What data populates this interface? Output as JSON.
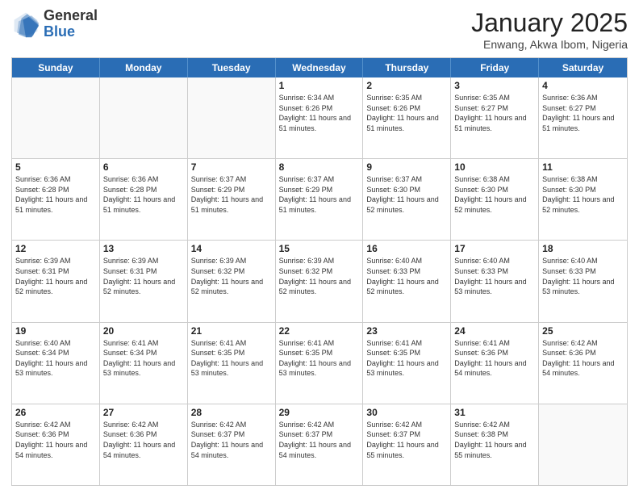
{
  "header": {
    "logo_general": "General",
    "logo_blue": "Blue",
    "month_title": "January 2025",
    "subtitle": "Enwang, Akwa Ibom, Nigeria"
  },
  "weekdays": [
    "Sunday",
    "Monday",
    "Tuesday",
    "Wednesday",
    "Thursday",
    "Friday",
    "Saturday"
  ],
  "weeks": [
    [
      {
        "day": "",
        "sunrise": "",
        "sunset": "",
        "daylight": "",
        "empty": true
      },
      {
        "day": "",
        "sunrise": "",
        "sunset": "",
        "daylight": "",
        "empty": true
      },
      {
        "day": "",
        "sunrise": "",
        "sunset": "",
        "daylight": "",
        "empty": true
      },
      {
        "day": "1",
        "sunrise": "Sunrise: 6:34 AM",
        "sunset": "Sunset: 6:26 PM",
        "daylight": "Daylight: 11 hours and 51 minutes.",
        "empty": false
      },
      {
        "day": "2",
        "sunrise": "Sunrise: 6:35 AM",
        "sunset": "Sunset: 6:26 PM",
        "daylight": "Daylight: 11 hours and 51 minutes.",
        "empty": false
      },
      {
        "day": "3",
        "sunrise": "Sunrise: 6:35 AM",
        "sunset": "Sunset: 6:27 PM",
        "daylight": "Daylight: 11 hours and 51 minutes.",
        "empty": false
      },
      {
        "day": "4",
        "sunrise": "Sunrise: 6:36 AM",
        "sunset": "Sunset: 6:27 PM",
        "daylight": "Daylight: 11 hours and 51 minutes.",
        "empty": false
      }
    ],
    [
      {
        "day": "5",
        "sunrise": "Sunrise: 6:36 AM",
        "sunset": "Sunset: 6:28 PM",
        "daylight": "Daylight: 11 hours and 51 minutes.",
        "empty": false
      },
      {
        "day": "6",
        "sunrise": "Sunrise: 6:36 AM",
        "sunset": "Sunset: 6:28 PM",
        "daylight": "Daylight: 11 hours and 51 minutes.",
        "empty": false
      },
      {
        "day": "7",
        "sunrise": "Sunrise: 6:37 AM",
        "sunset": "Sunset: 6:29 PM",
        "daylight": "Daylight: 11 hours and 51 minutes.",
        "empty": false
      },
      {
        "day": "8",
        "sunrise": "Sunrise: 6:37 AM",
        "sunset": "Sunset: 6:29 PM",
        "daylight": "Daylight: 11 hours and 51 minutes.",
        "empty": false
      },
      {
        "day": "9",
        "sunrise": "Sunrise: 6:37 AM",
        "sunset": "Sunset: 6:30 PM",
        "daylight": "Daylight: 11 hours and 52 minutes.",
        "empty": false
      },
      {
        "day": "10",
        "sunrise": "Sunrise: 6:38 AM",
        "sunset": "Sunset: 6:30 PM",
        "daylight": "Daylight: 11 hours and 52 minutes.",
        "empty": false
      },
      {
        "day": "11",
        "sunrise": "Sunrise: 6:38 AM",
        "sunset": "Sunset: 6:30 PM",
        "daylight": "Daylight: 11 hours and 52 minutes.",
        "empty": false
      }
    ],
    [
      {
        "day": "12",
        "sunrise": "Sunrise: 6:39 AM",
        "sunset": "Sunset: 6:31 PM",
        "daylight": "Daylight: 11 hours and 52 minutes.",
        "empty": false
      },
      {
        "day": "13",
        "sunrise": "Sunrise: 6:39 AM",
        "sunset": "Sunset: 6:31 PM",
        "daylight": "Daylight: 11 hours and 52 minutes.",
        "empty": false
      },
      {
        "day": "14",
        "sunrise": "Sunrise: 6:39 AM",
        "sunset": "Sunset: 6:32 PM",
        "daylight": "Daylight: 11 hours and 52 minutes.",
        "empty": false
      },
      {
        "day": "15",
        "sunrise": "Sunrise: 6:39 AM",
        "sunset": "Sunset: 6:32 PM",
        "daylight": "Daylight: 11 hours and 52 minutes.",
        "empty": false
      },
      {
        "day": "16",
        "sunrise": "Sunrise: 6:40 AM",
        "sunset": "Sunset: 6:33 PM",
        "daylight": "Daylight: 11 hours and 52 minutes.",
        "empty": false
      },
      {
        "day": "17",
        "sunrise": "Sunrise: 6:40 AM",
        "sunset": "Sunset: 6:33 PM",
        "daylight": "Daylight: 11 hours and 53 minutes.",
        "empty": false
      },
      {
        "day": "18",
        "sunrise": "Sunrise: 6:40 AM",
        "sunset": "Sunset: 6:33 PM",
        "daylight": "Daylight: 11 hours and 53 minutes.",
        "empty": false
      }
    ],
    [
      {
        "day": "19",
        "sunrise": "Sunrise: 6:40 AM",
        "sunset": "Sunset: 6:34 PM",
        "daylight": "Daylight: 11 hours and 53 minutes.",
        "empty": false
      },
      {
        "day": "20",
        "sunrise": "Sunrise: 6:41 AM",
        "sunset": "Sunset: 6:34 PM",
        "daylight": "Daylight: 11 hours and 53 minutes.",
        "empty": false
      },
      {
        "day": "21",
        "sunrise": "Sunrise: 6:41 AM",
        "sunset": "Sunset: 6:35 PM",
        "daylight": "Daylight: 11 hours and 53 minutes.",
        "empty": false
      },
      {
        "day": "22",
        "sunrise": "Sunrise: 6:41 AM",
        "sunset": "Sunset: 6:35 PM",
        "daylight": "Daylight: 11 hours and 53 minutes.",
        "empty": false
      },
      {
        "day": "23",
        "sunrise": "Sunrise: 6:41 AM",
        "sunset": "Sunset: 6:35 PM",
        "daylight": "Daylight: 11 hours and 53 minutes.",
        "empty": false
      },
      {
        "day": "24",
        "sunrise": "Sunrise: 6:41 AM",
        "sunset": "Sunset: 6:36 PM",
        "daylight": "Daylight: 11 hours and 54 minutes.",
        "empty": false
      },
      {
        "day": "25",
        "sunrise": "Sunrise: 6:42 AM",
        "sunset": "Sunset: 6:36 PM",
        "daylight": "Daylight: 11 hours and 54 minutes.",
        "empty": false
      }
    ],
    [
      {
        "day": "26",
        "sunrise": "Sunrise: 6:42 AM",
        "sunset": "Sunset: 6:36 PM",
        "daylight": "Daylight: 11 hours and 54 minutes.",
        "empty": false
      },
      {
        "day": "27",
        "sunrise": "Sunrise: 6:42 AM",
        "sunset": "Sunset: 6:36 PM",
        "daylight": "Daylight: 11 hours and 54 minutes.",
        "empty": false
      },
      {
        "day": "28",
        "sunrise": "Sunrise: 6:42 AM",
        "sunset": "Sunset: 6:37 PM",
        "daylight": "Daylight: 11 hours and 54 minutes.",
        "empty": false
      },
      {
        "day": "29",
        "sunrise": "Sunrise: 6:42 AM",
        "sunset": "Sunset: 6:37 PM",
        "daylight": "Daylight: 11 hours and 54 minutes.",
        "empty": false
      },
      {
        "day": "30",
        "sunrise": "Sunrise: 6:42 AM",
        "sunset": "Sunset: 6:37 PM",
        "daylight": "Daylight: 11 hours and 55 minutes.",
        "empty": false
      },
      {
        "day": "31",
        "sunrise": "Sunrise: 6:42 AM",
        "sunset": "Sunset: 6:38 PM",
        "daylight": "Daylight: 11 hours and 55 minutes.",
        "empty": false
      },
      {
        "day": "",
        "sunrise": "",
        "sunset": "",
        "daylight": "",
        "empty": true
      }
    ]
  ]
}
